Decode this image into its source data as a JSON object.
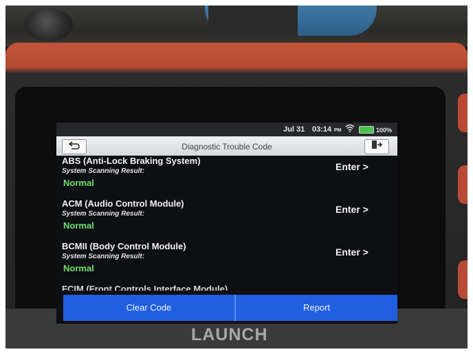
{
  "status_bar": {
    "date": "Jul 31",
    "time": "03:14",
    "ampm": "PM",
    "wifi_icon": "wifi-icon",
    "battery_color": "#49c24a",
    "battery_percent": "100%"
  },
  "title_bar": {
    "back_icon": "back-arrow-icon",
    "title": "Diagnostic Trouble Code",
    "exit_icon": "exit-icon"
  },
  "modules": [
    {
      "name": "ABS (Anti-Lock Braking System)",
      "subtitle": "System Scanning Result:",
      "result": "Normal",
      "action": "Enter >"
    },
    {
      "name": "ACM (Audio Control Module)",
      "subtitle": "System Scanning Result:",
      "result": "Normal",
      "action": "Enter >"
    },
    {
      "name": "BCMII (Body Control Module)",
      "subtitle": "System Scanning Result:",
      "result": "Normal",
      "action": "Enter >"
    }
  ],
  "partial_module_name": "FCIM (Front Controls Interface Module)",
  "bottom_bar": {
    "clear_code_label": "Clear Code",
    "report_label": "Report"
  },
  "device_logo": "LAUNCH",
  "colors": {
    "accent_blue": "#1f5fe0",
    "result_green": "#6fe06e"
  }
}
